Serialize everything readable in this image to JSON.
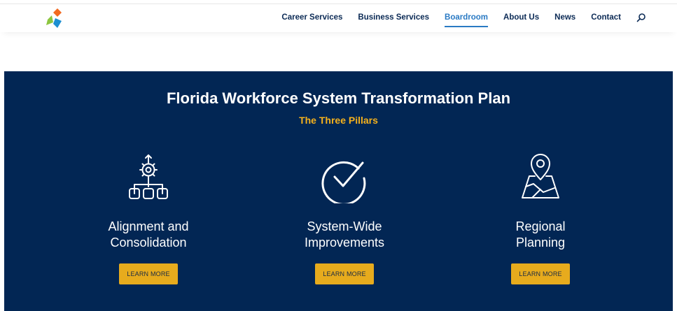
{
  "header": {
    "logo_colors": {
      "top": "#f26b21",
      "left": "#8dc63f",
      "right": "#1d8fd1"
    },
    "nav": [
      {
        "label": "Career Services",
        "active": false
      },
      {
        "label": "Business Services",
        "active": false
      },
      {
        "label": "Boardroom",
        "active": true
      },
      {
        "label": "About Us",
        "active": false
      },
      {
        "label": "News",
        "active": false
      },
      {
        "label": "Contact",
        "active": false
      }
    ],
    "search_icon": "search-icon"
  },
  "hero": {
    "title": "Florida Workforce System Transformation Plan",
    "subtitle": "The Three Pillars",
    "colors": {
      "background": "#022654",
      "accent": "#f5b11c",
      "button": "#e7ab1d"
    },
    "pillars": [
      {
        "name_line1": "Alignment and",
        "name_line2": "Consolidation",
        "icon": "hierarchy-gear-icon",
        "button": "LEARN MORE"
      },
      {
        "name_line1": "System-Wide",
        "name_line2": "Improvements",
        "icon": "checkmark-circle-icon",
        "button": "LEARN MORE"
      },
      {
        "name_line1": "Regional",
        "name_line2": "Planning",
        "icon": "map-pin-icon",
        "button": "LEARN MORE"
      }
    ]
  }
}
